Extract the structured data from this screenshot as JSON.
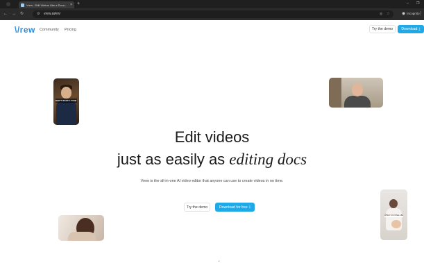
{
  "browser": {
    "tab_title": "Vrew - Edit Videos Like a Docu...",
    "tab_close": "×",
    "new_tab": "+",
    "url": "vrew.ai/en/",
    "incognito_label": "Incognito",
    "window_minimize": "–",
    "window_restore": "❐"
  },
  "header": {
    "logo": "\\/rew",
    "nav": [
      "Community",
      "Pricing"
    ],
    "try_demo": "Try the demo",
    "download": "Download"
  },
  "hero": {
    "line1": "Edit videos",
    "line2_plain": "just as easily as ",
    "line2_italic": "editing docs",
    "subtitle": "Vrew is the all-in-one AI video editor that anyone can use to create videos in no time.",
    "try_demo": "Try the demo",
    "download": "Download for free"
  },
  "thumbs": {
    "napoleon_caption": "DON'T WASTE YOUR TIME",
    "mom_caption": "WHEN YOU HAVE A BABY"
  },
  "icons": {
    "download": "download-arrow-icon",
    "chevron": "chevron-down-icon"
  },
  "colors": {
    "brand": "#2f8bd9",
    "accent": "#1fa9e6",
    "chrome": "#1f1f1f"
  }
}
